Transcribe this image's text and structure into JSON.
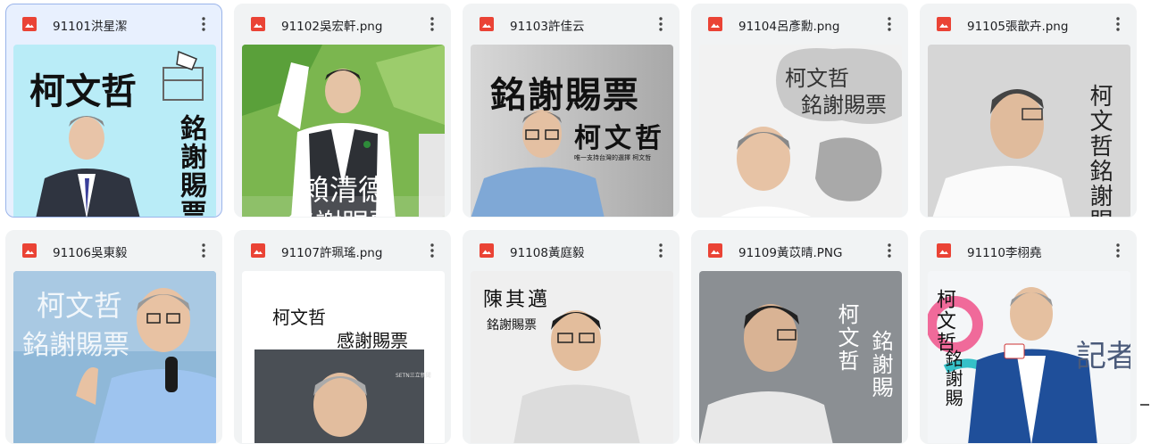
{
  "files": [
    {
      "name": "91101洪星潔",
      "selected": true,
      "captions": {
        "a": "柯文哲",
        "b": "銘謝賜票"
      }
    },
    {
      "name": "91102吳宏軒.png",
      "selected": false,
      "captions": {
        "a": "賴清德",
        "b": "銘謝賜票"
      }
    },
    {
      "name": "91103許佳云",
      "selected": false,
      "captions": {
        "a": "銘謝賜票",
        "b": "柯文哲",
        "c": "唯一支持台灣的選擇 柯文哲"
      }
    },
    {
      "name": "91104呂彥勳.png",
      "selected": false,
      "captions": {
        "a": "柯文哲",
        "b": "銘謝賜票"
      }
    },
    {
      "name": "91105張歆卉.png",
      "selected": false,
      "captions": {
        "a": "柯文哲銘謝賜票"
      }
    },
    {
      "name": "91106吳東毅",
      "selected": false,
      "captions": {
        "a": "柯文哲",
        "b": "銘謝賜票"
      }
    },
    {
      "name": "91107許珮瑤.png",
      "selected": false,
      "captions": {
        "a": "柯文哲",
        "b": "感謝賜票",
        "c": "SETN三立新聞"
      }
    },
    {
      "name": "91108黃庭毅",
      "selected": false,
      "captions": {
        "a": "陳其邁",
        "b": "銘謝賜票"
      }
    },
    {
      "name": "91109黃苡晴.PNG",
      "selected": false,
      "captions": {
        "a": "柯文哲",
        "b": "銘謝賜"
      }
    },
    {
      "name": "91110李栩堯",
      "selected": false,
      "captions": {
        "a": "柯文哲",
        "b": "銘謝賜",
        "c": "記者"
      }
    }
  ],
  "icons": {
    "file_type": "image-file-icon",
    "menu": "more-vert-icon"
  },
  "colors": {
    "image_icon": "#ea4335",
    "card_bg": "#f1f3f4",
    "selected_bg": "#e8f0fe",
    "selected_border": "#9ab4ea"
  }
}
